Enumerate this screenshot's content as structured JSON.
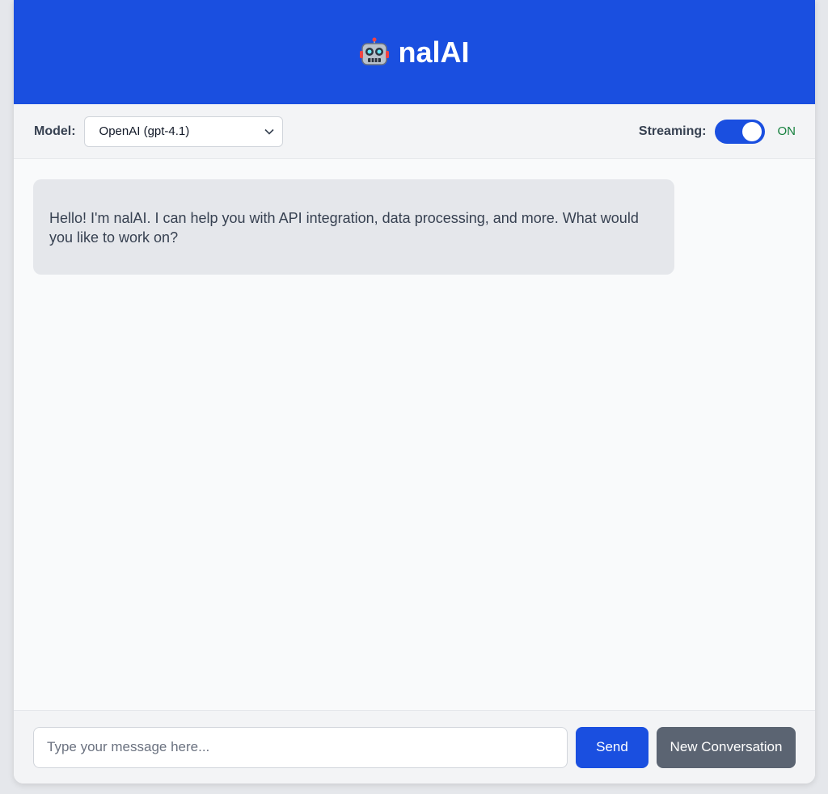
{
  "header": {
    "title": "nalAI",
    "icon": "robot-icon"
  },
  "toolbar": {
    "model_label": "Model:",
    "model_selected": "OpenAI (gpt-4.1)",
    "streaming_label": "Streaming:",
    "streaming_state": "ON",
    "streaming_enabled": true
  },
  "chat": {
    "messages": [
      {
        "role": "assistant",
        "text": "Hello! I'm nalAI. I can help you with API integration, data processing, and more. What would you like to work on?"
      }
    ]
  },
  "composer": {
    "placeholder": "Type your message here...",
    "value": "",
    "send_label": "Send",
    "new_conversation_label": "New Conversation"
  },
  "colors": {
    "accent": "#1a4fe0",
    "secondary_button": "#5b6472",
    "toggle_on_text": "#15803d"
  }
}
